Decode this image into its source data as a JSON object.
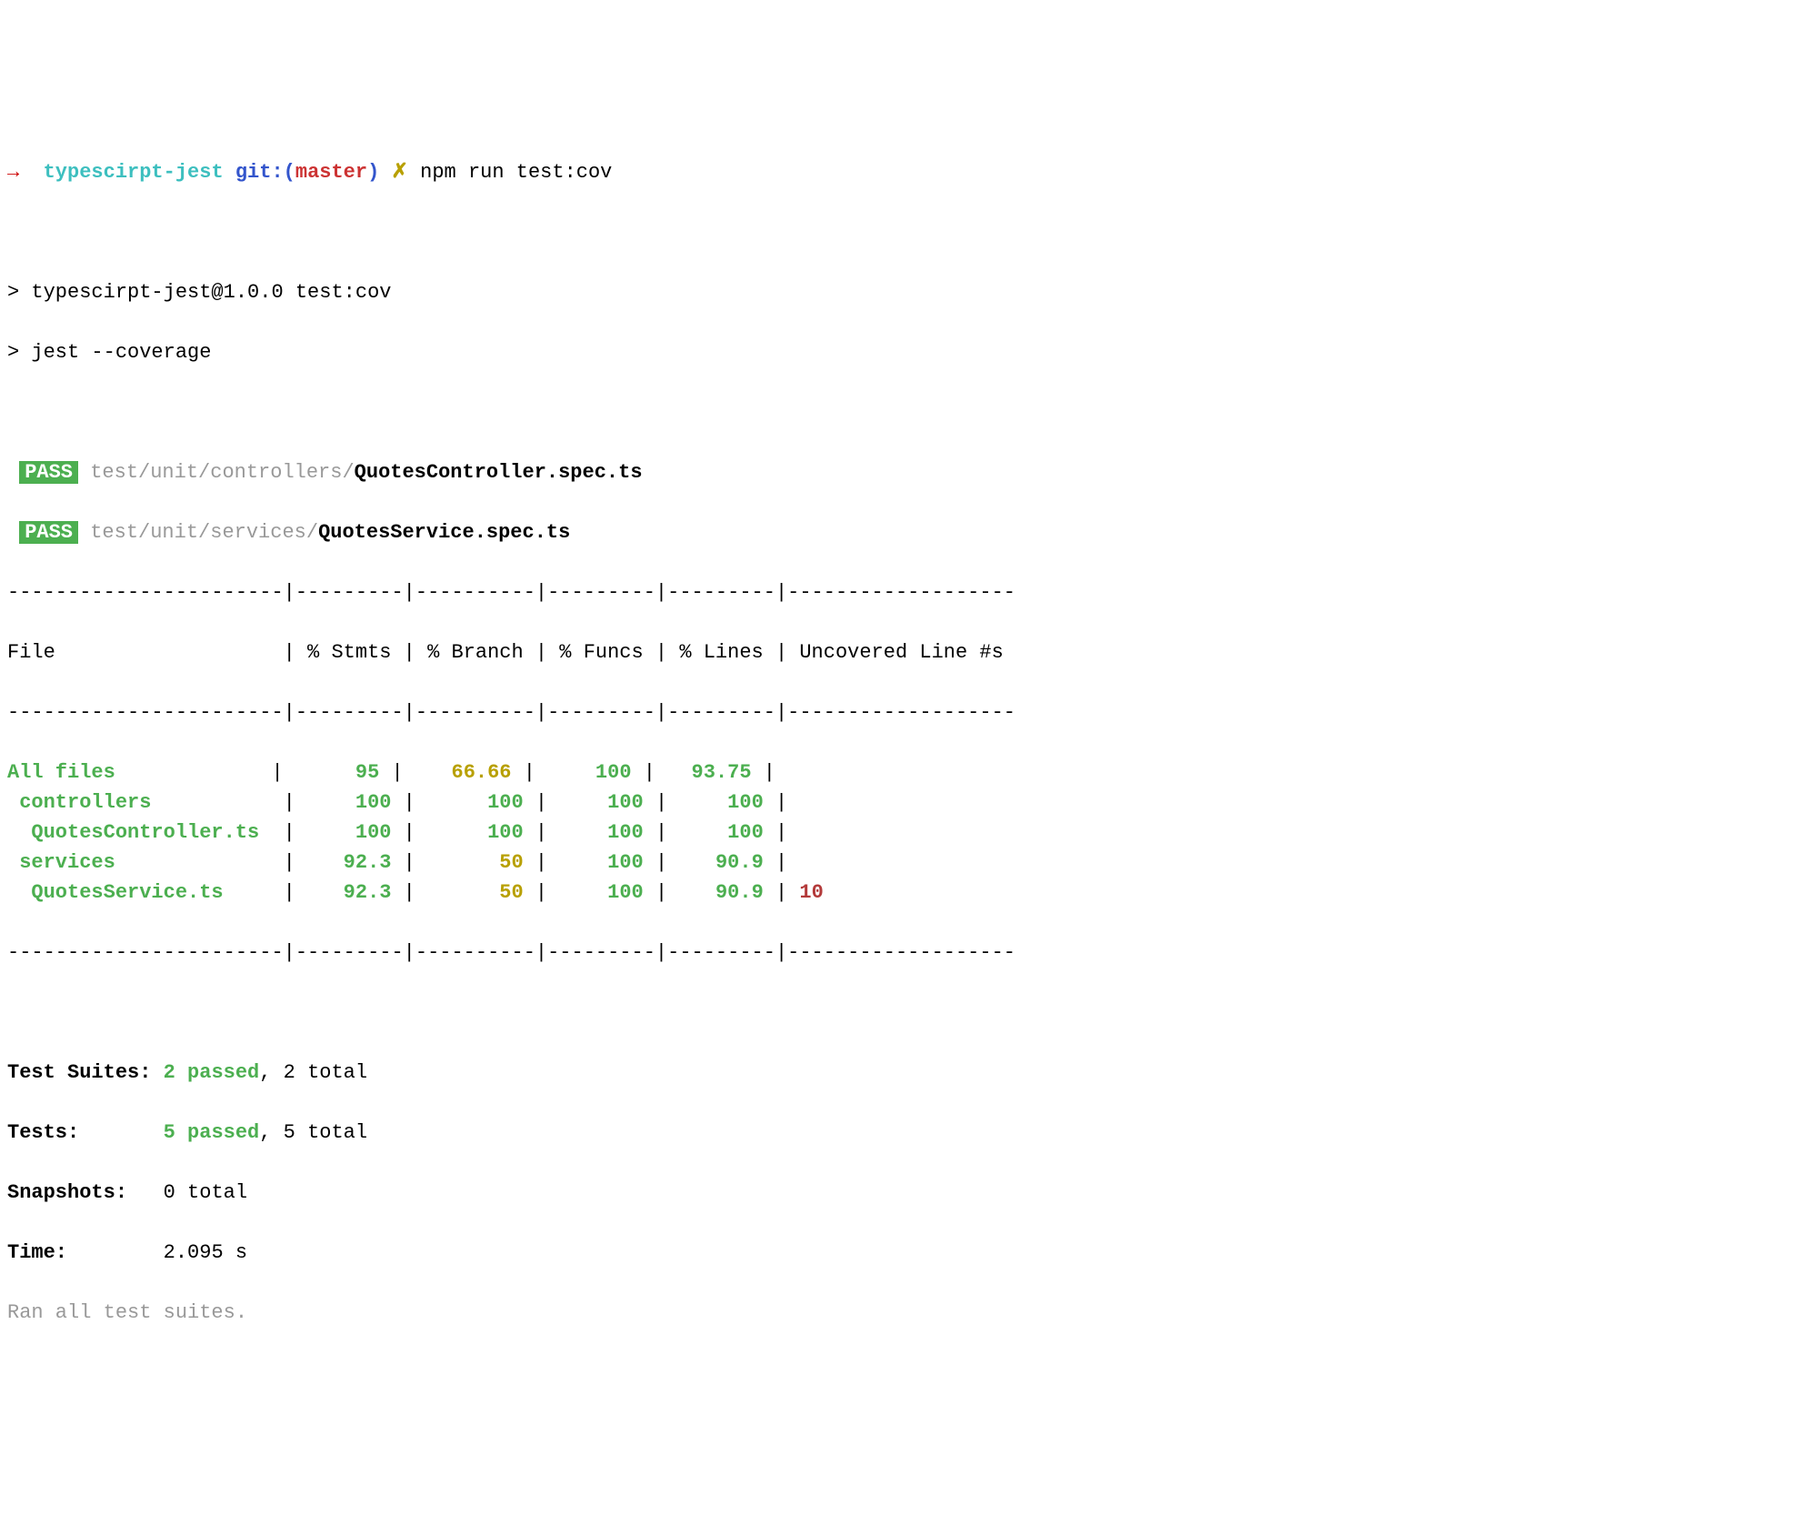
{
  "prompt": {
    "arrow": "→",
    "dir": "typescirpt-jest",
    "git_label": "git:(",
    "branch": "master",
    "git_close": ")",
    "dirty": "✗",
    "command": "npm run test:cov"
  },
  "npm_output": {
    "line1": "> typescirpt-jest@1.0.0 test:cov",
    "line2": "> jest --coverage"
  },
  "test_files": [
    {
      "badge": "PASS",
      "path_prefix": "test/unit/controllers/",
      "file": "QuotesController.spec.ts"
    },
    {
      "badge": "PASS",
      "path_prefix": "test/unit/services/",
      "file": "QuotesService.spec.ts"
    }
  ],
  "coverage": {
    "sep_top": "-----------------------|---------|----------|---------|---------|-------------------",
    "header": "File                   | % Stmts | % Branch | % Funcs | % Lines | Uncovered Line #s ",
    "sep_mid": "-----------------------|---------|----------|---------|---------|-------------------",
    "rows": [
      {
        "name": "All files           ",
        "stmts": "     95",
        "stmts_c": "green",
        "branch": "   66.66",
        "branch_c": "yellow",
        "funcs": "    100",
        "funcs_c": "green",
        "lines": "  93.75",
        "lines_c": "green",
        "uncov": "                  ",
        "uncov_c": "green"
      },
      {
        "name": " controllers         ",
        "stmts": "    100",
        "stmts_c": "green",
        "branch": "     100",
        "branch_c": "green",
        "funcs": "    100",
        "funcs_c": "green",
        "lines": "    100",
        "lines_c": "green",
        "uncov": "                  ",
        "uncov_c": "green"
      },
      {
        "name": "  QuotesController.ts",
        "stmts": "    100",
        "stmts_c": "green",
        "branch": "     100",
        "branch_c": "green",
        "funcs": "    100",
        "funcs_c": "green",
        "lines": "    100",
        "lines_c": "green",
        "uncov": "                  ",
        "uncov_c": "green"
      },
      {
        "name": " services            ",
        "stmts": "   92.3",
        "stmts_c": "green",
        "branch": "      50",
        "branch_c": "yellow",
        "funcs": "    100",
        "funcs_c": "green",
        "lines": "   90.9",
        "lines_c": "green",
        "uncov": "                  ",
        "uncov_c": "green"
      },
      {
        "name": "  QuotesService.ts   ",
        "stmts": "   92.3",
        "stmts_c": "green",
        "branch": "      50",
        "branch_c": "yellow",
        "funcs": "    100",
        "funcs_c": "green",
        "lines": "   90.9",
        "lines_c": "green",
        "uncov": "10                ",
        "uncov_c": "red"
      }
    ],
    "sep_bot": "-----------------------|---------|----------|---------|---------|-------------------"
  },
  "summary": {
    "suites_label": "Test Suites: ",
    "suites_passed": "2 passed",
    "suites_rest": ", 2 total",
    "tests_label": "Tests:       ",
    "tests_passed": "5 passed",
    "tests_rest": ", 5 total",
    "snapshots_label": "Snapshots:   ",
    "snapshots_rest": "0 total",
    "time_label": "Time:        ",
    "time_rest": "2.095 s",
    "ran": "Ran all test suites."
  }
}
